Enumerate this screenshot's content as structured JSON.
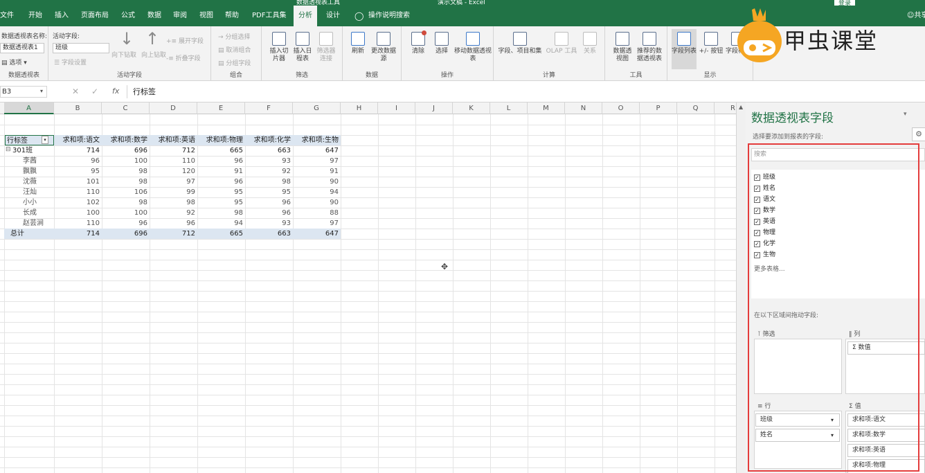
{
  "titlebar": {
    "context_tool": "数据透视表工具",
    "doc_title": "演示文稿 - Excel",
    "login": "登录"
  },
  "menubar": {
    "tabs": [
      "文件",
      "开始",
      "插入",
      "页面布局",
      "公式",
      "数据",
      "审阅",
      "视图",
      "帮助",
      "PDF工具集",
      "分析",
      "设计"
    ],
    "active_tab": "分析",
    "tell_me": "操作说明搜索",
    "share": "共享"
  },
  "ribbon": {
    "pivot_group": {
      "name_label": "数据透视表名称:",
      "name_value": "数据透视表1",
      "options": "选项",
      "label": "数据透视表"
    },
    "active_field": {
      "label": "活动字段:",
      "value": "班级",
      "settings": "字段设置",
      "drill_down": "向下钻取",
      "drill_up": "向上钻取",
      "expand": "展开字段",
      "collapse": "折叠字段",
      "group_label": "活动字段"
    },
    "group": {
      "sel": "分组选择",
      "ungroup": "取消组合",
      "field": "分组字段",
      "label": "组合"
    },
    "filter": {
      "slicer": "插入切片器",
      "timeline": "插入日程表",
      "connections": "筛选器连接",
      "label": "筛选"
    },
    "data": {
      "refresh": "刷新",
      "change_source": "更改数据源",
      "label": "数据"
    },
    "actions": {
      "clear": "清除",
      "select": "选择",
      "move": "移动数据透视表",
      "label": "操作"
    },
    "calc": {
      "fields": "字段、项目和集",
      "olap": "OLAP 工具",
      "relations": "关系",
      "label": "计算"
    },
    "tools": {
      "pivotchart": "数据透视图",
      "recommended": "推荐的数据透视表",
      "label": "工具"
    },
    "show": {
      "field_list": "字段列表",
      "buttons": "+/- 按钮",
      "headers": "字段标题",
      "label": "显示"
    }
  },
  "logo": {
    "text": "甲虫课堂"
  },
  "formula_bar": {
    "name_box": "B3",
    "fx": "fx",
    "content": "行标签"
  },
  "columns": [
    "A",
    "B",
    "C",
    "D",
    "E",
    "F",
    "G",
    "H",
    "I",
    "J",
    "K",
    "L",
    "M",
    "N",
    "O",
    "P",
    "Q",
    "R"
  ],
  "pivot": {
    "headers": [
      "行标签",
      "求和项:语文",
      "求和项:数学",
      "求和项:英语",
      "求和项:物理",
      "求和项:化学",
      "求和项:生物"
    ],
    "group_row": {
      "label": "301班",
      "values": [
        "714",
        "696",
        "712",
        "665",
        "663",
        "647"
      ]
    },
    "rows": [
      {
        "name": "李茜",
        "values": [
          "96",
          "100",
          "110",
          "96",
          "93",
          "97"
        ]
      },
      {
        "name": "飘飘",
        "values": [
          "95",
          "98",
          "120",
          "91",
          "92",
          "91"
        ]
      },
      {
        "name": "沈薇",
        "values": [
          "101",
          "98",
          "97",
          "96",
          "98",
          "90"
        ]
      },
      {
        "name": "汪灿",
        "values": [
          "110",
          "106",
          "99",
          "95",
          "95",
          "94"
        ]
      },
      {
        "name": "小小",
        "values": [
          "102",
          "98",
          "98",
          "95",
          "96",
          "90"
        ]
      },
      {
        "name": "长成",
        "values": [
          "100",
          "100",
          "92",
          "98",
          "96",
          "88"
        ]
      },
      {
        "name": "赵芸涧",
        "values": [
          "110",
          "96",
          "96",
          "94",
          "93",
          "97"
        ]
      }
    ],
    "total": {
      "label": "总计",
      "values": [
        "714",
        "696",
        "712",
        "665",
        "663",
        "647"
      ]
    }
  },
  "panel": {
    "title": "数据透视表字段",
    "subtitle": "选择要添加到报表的字段:",
    "search_placeholder": "搜索",
    "fields": [
      "班级",
      "姓名",
      "语文",
      "数学",
      "英语",
      "物理",
      "化学",
      "生物"
    ],
    "more_tables": "更多表格...",
    "drag_hint": "在以下区域间拖动字段:",
    "areas": {
      "filter": "筛选",
      "columns": "列",
      "rows": "行",
      "values": "值",
      "columns_items": [
        "Σ 数值"
      ],
      "rows_items": [
        "班级",
        "姓名"
      ],
      "values_items": [
        "求和项:语文",
        "求和项:数学",
        "求和项:英语",
        "求和项:物理"
      ]
    }
  },
  "colors": {
    "excel_green": "#217346",
    "pivot_header": "#dce6f1",
    "highlight_box": "#e43c3c",
    "logo_orange": "#f5a623"
  }
}
